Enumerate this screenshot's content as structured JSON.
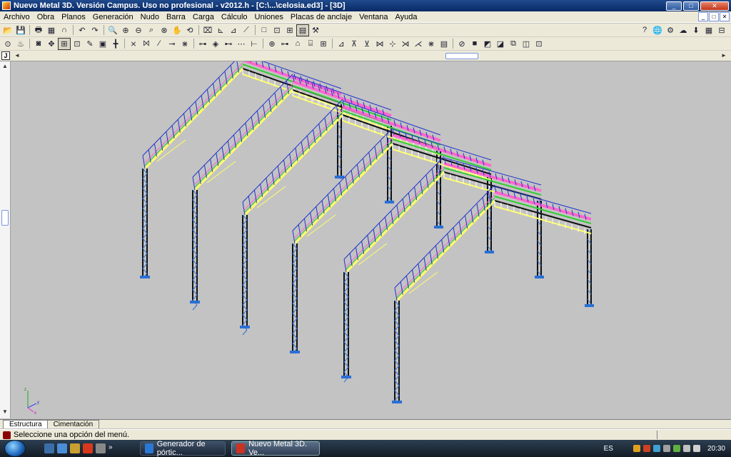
{
  "window": {
    "title": "Nuevo Metal 3D. Versión Campus. Uso no profesional - v2012.h - [C:\\...\\celosia.ed3] - [3D]",
    "btn_min": "_",
    "btn_max": "□",
    "btn_close": "✕"
  },
  "menu": {
    "items": [
      "Archivo",
      "Obra",
      "Planos",
      "Generación",
      "Nudo",
      "Barra",
      "Carga",
      "Cálculo",
      "Uniones",
      "Placas de anclaje",
      "Ventana",
      "Ayuda"
    ]
  },
  "toolbar1": {
    "icons": [
      "open-icon",
      "save-icon",
      "print-icon",
      "preview-icon",
      "magnet-icon",
      "undo-icon",
      "redo-icon",
      "zoom-window-icon",
      "zoom-all-icon",
      "zoom-in-icon",
      "zoom-prev-icon",
      "zoom-out-icon",
      "pan-icon",
      "rotate-icon",
      "view-3d-icon",
      "axis-x-icon",
      "axis-y-icon",
      "axis-z-icon",
      "frame-icon",
      "node-icon",
      "bar-icon",
      "grid-icon",
      "tools-icon"
    ],
    "glyphs": [
      "📂",
      "💾",
      "🖶",
      "▦",
      "∩",
      "↶",
      "↷",
      "🔍",
      "⊕",
      "⊖",
      "⌕",
      "⊗",
      "✋",
      "⟲",
      "⌧",
      "⊾",
      "⊿",
      "⟋",
      "□",
      "⊡",
      "⊞",
      "▤",
      "⚒"
    ],
    "right_glyphs": [
      "?",
      "🌐",
      "⚙",
      "☁",
      "⬇",
      "▦",
      "⊟"
    ]
  },
  "toolbar2": {
    "glyphs": [
      "⊙",
      "♨",
      "◙",
      "✥",
      "⊞",
      "⊡",
      "✎",
      "▣",
      "╋",
      "⨯",
      "⨝",
      "⁄",
      "⊸",
      "⋇",
      "⊶",
      "◈",
      "⊷",
      "⋯",
      "⊢",
      "⊕",
      "⊶",
      "⌂",
      "⌸",
      "⊞",
      "⊿",
      "⊼",
      "⊻",
      "⋈",
      "⊹",
      "⋊",
      "⋌",
      "⋇",
      "▤",
      "⊘",
      "■",
      "◩",
      "◪",
      "⧉",
      "◫",
      "⊡"
    ]
  },
  "viewport": {
    "axis_label_x": "x",
    "axis_label_y": "y",
    "axis_label_z": "z"
  },
  "corner": {
    "label": "J"
  },
  "tabs": {
    "estructura": "Estructura",
    "cimentacion": "Cimentación"
  },
  "status": {
    "text": "Seleccione una opción del menú."
  },
  "taskbar": {
    "task1": "Generador de pórtic...",
    "task2": "Nuevo Metal 3D. Ve...",
    "lang": "ES",
    "time": "20:30",
    "ql_more": "»"
  },
  "colors": {
    "viewport_bg": "#c3c3c3",
    "column": "#111111",
    "column_bracing": "#2a6fd6",
    "rafter_purlin": "#ff66cc",
    "roof_sheeting": "#2233cc",
    "bracing": "#ffff66",
    "eave_beam": "#33cc33"
  }
}
